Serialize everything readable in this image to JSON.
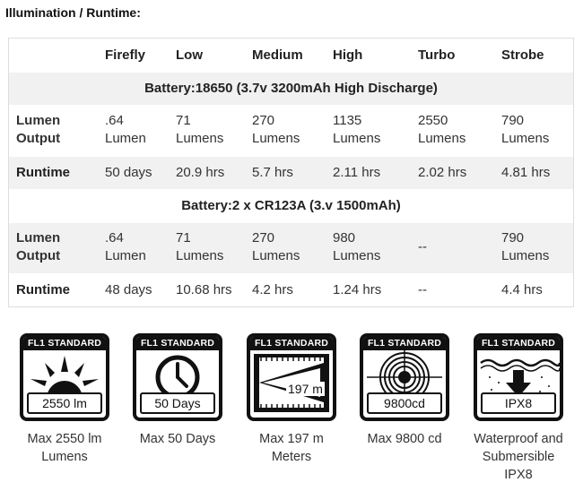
{
  "title": "Illumination / Runtime:",
  "table": {
    "modes": [
      "Firefly",
      "Low",
      "Medium",
      "High",
      "Turbo",
      "Strobe"
    ],
    "sections": [
      {
        "battery": "Battery:18650 (3.7v 3200mAh High Discharge)",
        "lumen_label": "Lumen\nOutput",
        "lumens": [
          ".64\nLumen",
          "71\nLumens",
          "270\nLumens",
          "1135\nLumens",
          "2550\nLumens",
          "790\nLumens"
        ],
        "runtime_label": "Runtime",
        "runtimes": [
          "50 days",
          "20.9 hrs",
          "5.7 hrs",
          "2.11 hrs",
          "2.02 hrs",
          "4.81 hrs"
        ]
      },
      {
        "battery": "Battery:2 x CR123A (3.v 1500mAh)",
        "lumen_label": "Lumen\nOutput",
        "lumens": [
          ".64\nLumen",
          "71\nLumens",
          "270\nLumens",
          "980\nLumens",
          "--",
          "790\nLumens"
        ],
        "runtime_label": "Runtime",
        "runtimes": [
          "48 days",
          "10.68 hrs",
          "4.2 hrs",
          "1.24 hrs",
          "--",
          "4.4 hrs"
        ]
      }
    ]
  },
  "icons": [
    {
      "header": "FL1 STANDARD",
      "icon": "sun-icon",
      "value": "2550 lm",
      "caption": "Max 2550 lm\nLumens"
    },
    {
      "header": "FL1 STANDARD",
      "icon": "clock-icon",
      "value": "50 Days",
      "caption": "Max 50 Days"
    },
    {
      "header": "FL1 STANDARD",
      "icon": "beam-distance-icon",
      "value": "197 m",
      "caption": "Max 197 m\nMeters"
    },
    {
      "header": "FL1 STANDARD",
      "icon": "target-icon",
      "value": "9800cd",
      "caption": "Max 9800 cd"
    },
    {
      "header": "FL1 STANDARD",
      "icon": "water-icon",
      "value": "IPX8",
      "caption": "Waterproof and\nSubmersible\nIPX8"
    }
  ]
}
